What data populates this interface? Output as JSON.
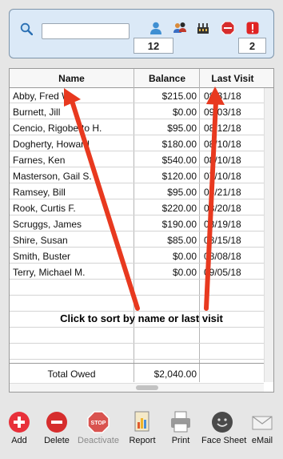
{
  "search": {
    "value": "",
    "placeholder": ""
  },
  "toolbar": {
    "icons": [
      "search-icon",
      "person-icon",
      "person-group-icon",
      "clinic-icon",
      "stop-sign-icon",
      "alert-icon"
    ],
    "active_count": "12",
    "alert_count": "2"
  },
  "table": {
    "columns": [
      "Name",
      "Balance",
      "Last Visit"
    ],
    "rows": [
      {
        "name": "Abby, Fred W.",
        "balance": "$215.00",
        "last_visit": "08/31/18"
      },
      {
        "name": "Burnett, Jill",
        "balance": "$0.00",
        "last_visit": "09/03/18"
      },
      {
        "name": "Cencio, Rigoberto H.",
        "balance": "$95.00",
        "last_visit": "08/12/18"
      },
      {
        "name": "Dogherty, Howard",
        "balance": "$180.00",
        "last_visit": "08/10/18"
      },
      {
        "name": "Farnes, Ken",
        "balance": "$540.00",
        "last_visit": "08/10/18"
      },
      {
        "name": "Masterson, Gail S.",
        "balance": "$120.00",
        "last_visit": "07/10/18"
      },
      {
        "name": "Ramsey, Bill",
        "balance": "$95.00",
        "last_visit": "08/21/18"
      },
      {
        "name": "Rook, Curtis F.",
        "balance": "$220.00",
        "last_visit": "08/20/18"
      },
      {
        "name": "Scruggs, James",
        "balance": "$190.00",
        "last_visit": "08/19/18"
      },
      {
        "name": "Shire, Susan",
        "balance": "$85.00",
        "last_visit": "08/15/18"
      },
      {
        "name": "Smith, Buster",
        "balance": "$0.00",
        "last_visit": "08/08/18"
      },
      {
        "name": "Terry, Michael M.",
        "balance": "$0.00",
        "last_visit": "09/05/18"
      }
    ],
    "total_label": "Total Owed",
    "total_value": "$2,040.00"
  },
  "annotation": "Click to sort by name or last visit",
  "colors": {
    "arrow": "#e8391f",
    "toolbar_bg": "#dbe9f7",
    "add": "#e8303a",
    "delete": "#d62d2d"
  },
  "bottom_bar": [
    {
      "label": "Add",
      "icon": "add-icon",
      "enabled": true
    },
    {
      "label": "Delete",
      "icon": "delete-icon",
      "enabled": true
    },
    {
      "label": "Deactivate",
      "icon": "stop-sign-icon",
      "enabled": false
    },
    {
      "label": "Report",
      "icon": "report-icon",
      "enabled": true
    },
    {
      "label": "Print",
      "icon": "printer-icon",
      "enabled": true
    },
    {
      "label": "Face Sheet",
      "icon": "face-icon",
      "enabled": true
    },
    {
      "label": "eMail",
      "icon": "email-icon",
      "enabled": true
    }
  ]
}
